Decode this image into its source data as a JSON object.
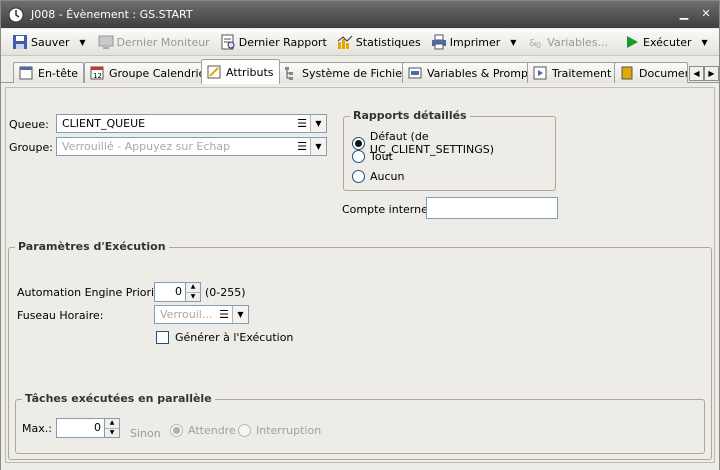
{
  "window": {
    "title": "J008 - Évènement : GS.START"
  },
  "toolbar": {
    "save": "Sauver",
    "last_monitor": "Dernier Moniteur",
    "last_report": "Dernier Rapport",
    "statistics": "Statistiques",
    "print": "Imprimer",
    "variables": "Variables...",
    "execute": "Exécuter"
  },
  "tabs": [
    "En-tête",
    "Groupe Calendrier",
    "Attributs",
    "Système de Fichiers",
    "Variables & Prompts",
    "Traitement",
    "Document"
  ],
  "tab_calendar_number": "12",
  "active_tab": "Attributs",
  "form": {
    "queue_label": "Queue:",
    "queue_value": "CLIENT_QUEUE",
    "group_label": "Groupe:",
    "group_placeholder": "Verrouillé - Appuyez sur Echap",
    "reports": {
      "title": "Rapports détaillés",
      "options": [
        "Défaut (de UC_CLIENT_SETTINGS)",
        "Tout",
        "Aucun"
      ],
      "selected": 0
    },
    "internal_account_label": "Compte interne:",
    "internal_account_value": ""
  },
  "execution": {
    "title": "Paramètres d'Exécution",
    "priority_label": "Automation Engine Priorité:",
    "priority_value": "0",
    "priority_range": "(0-255)",
    "timezone_label": "Fuseau Horaire:",
    "timezone_value": "Verrouil...",
    "generate_label": "Générer à l'Exécution",
    "generate_checked": false
  },
  "parallel": {
    "title": "Tâches exécutées en parallèle",
    "max_label": "Max.:",
    "max_value": "0",
    "otherwise_label": "Sinon",
    "options": [
      "Attendre",
      "Interruption"
    ],
    "selected": 0
  }
}
